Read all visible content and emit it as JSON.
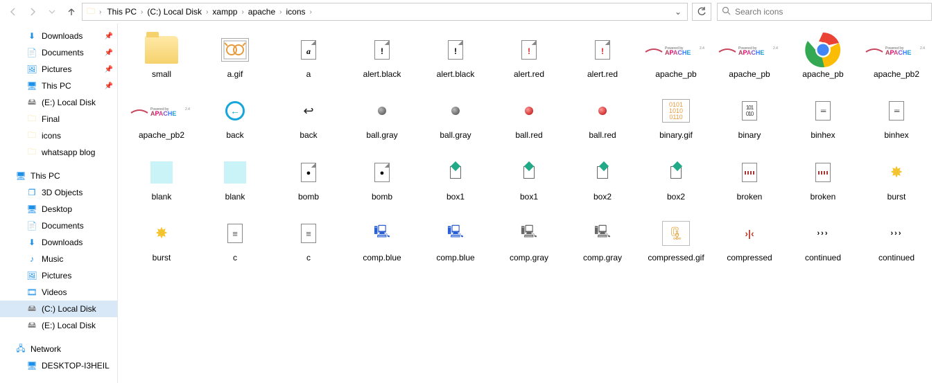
{
  "toolbar": {
    "back_enabled": false,
    "fwd_enabled": false
  },
  "breadcrumbs": [
    "This PC",
    "(C:) Local Disk",
    "xampp",
    "apache",
    "icons"
  ],
  "search_placeholder": "Search icons",
  "nav": {
    "quick": [
      {
        "label": "Downloads",
        "icon": "download",
        "pinned": true
      },
      {
        "label": "Documents",
        "icon": "docs",
        "pinned": true
      },
      {
        "label": "Pictures",
        "icon": "pics",
        "pinned": true
      },
      {
        "label": "This PC",
        "icon": "pc",
        "pinned": true
      },
      {
        "label": "(E:) Local Disk",
        "icon": "disk",
        "pinned": false
      },
      {
        "label": "Final",
        "icon": "folder",
        "pinned": false
      },
      {
        "label": "icons",
        "icon": "folder",
        "pinned": false
      },
      {
        "label": "whatsapp blog",
        "icon": "folder",
        "pinned": false
      }
    ],
    "thispc_label": "This PC",
    "thispc": [
      {
        "label": "3D Objects",
        "icon": "3d"
      },
      {
        "label": "Desktop",
        "icon": "desktop"
      },
      {
        "label": "Documents",
        "icon": "docs"
      },
      {
        "label": "Downloads",
        "icon": "download"
      },
      {
        "label": "Music",
        "icon": "music"
      },
      {
        "label": "Pictures",
        "icon": "pics"
      },
      {
        "label": "Videos",
        "icon": "video"
      },
      {
        "label": "(C:) Local Disk",
        "icon": "disk",
        "selected": true
      },
      {
        "label": "(E:) Local Disk",
        "icon": "disk"
      }
    ],
    "network_label": "Network",
    "network": [
      {
        "label": "DESKTOP-I3HEIL",
        "icon": "pc"
      }
    ]
  },
  "items": [
    {
      "label": "small",
      "type": "folder"
    },
    {
      "label": "a.gif",
      "type": "gif-a"
    },
    {
      "label": "a",
      "type": "page-a"
    },
    {
      "label": "alert.black",
      "type": "page-bang"
    },
    {
      "label": "alert.black",
      "type": "page-bang"
    },
    {
      "label": "alert.red",
      "type": "page-bang-red"
    },
    {
      "label": "alert.red",
      "type": "page-bang-red"
    },
    {
      "label": "apache_pb",
      "type": "apache"
    },
    {
      "label": "apache_pb",
      "type": "apache"
    },
    {
      "label": "apache_pb",
      "type": "chrome"
    },
    {
      "label": "apache_pb2",
      "type": "apache"
    },
    {
      "label": "apache_pb2",
      "type": "apache"
    },
    {
      "label": "back",
      "type": "back-circle"
    },
    {
      "label": "back",
      "type": "back-arrow"
    },
    {
      "label": "ball.gray",
      "type": "ball-gray"
    },
    {
      "label": "ball.gray",
      "type": "ball-gray"
    },
    {
      "label": "ball.red",
      "type": "ball-red"
    },
    {
      "label": "ball.red",
      "type": "ball-red"
    },
    {
      "label": "binary.gif",
      "type": "binary-gif"
    },
    {
      "label": "binary",
      "type": "binary"
    },
    {
      "label": "binhex",
      "type": "binhex"
    },
    {
      "label": "binhex",
      "type": "binhex"
    },
    {
      "label": "blank",
      "type": "blank"
    },
    {
      "label": "blank",
      "type": "blank"
    },
    {
      "label": "bomb",
      "type": "bomb"
    },
    {
      "label": "bomb",
      "type": "bomb"
    },
    {
      "label": "box1",
      "type": "box"
    },
    {
      "label": "box1",
      "type": "box"
    },
    {
      "label": "box2",
      "type": "box2"
    },
    {
      "label": "box2",
      "type": "box2"
    },
    {
      "label": "broken",
      "type": "broken"
    },
    {
      "label": "broken",
      "type": "broken"
    },
    {
      "label": "burst",
      "type": "burst"
    },
    {
      "label": "burst",
      "type": "burst"
    },
    {
      "label": "c",
      "type": "cfile"
    },
    {
      "label": "c",
      "type": "cfile"
    },
    {
      "label": "comp.blue",
      "type": "comp-blue"
    },
    {
      "label": "comp.blue",
      "type": "comp-blue"
    },
    {
      "label": "comp.gray",
      "type": "comp-gray"
    },
    {
      "label": "comp.gray",
      "type": "comp-gray"
    },
    {
      "label": "compressed.gif",
      "type": "compressed-gif"
    },
    {
      "label": "compressed",
      "type": "compressed"
    },
    {
      "label": "continued",
      "type": "continued"
    },
    {
      "label": "continued",
      "type": "continued"
    }
  ]
}
